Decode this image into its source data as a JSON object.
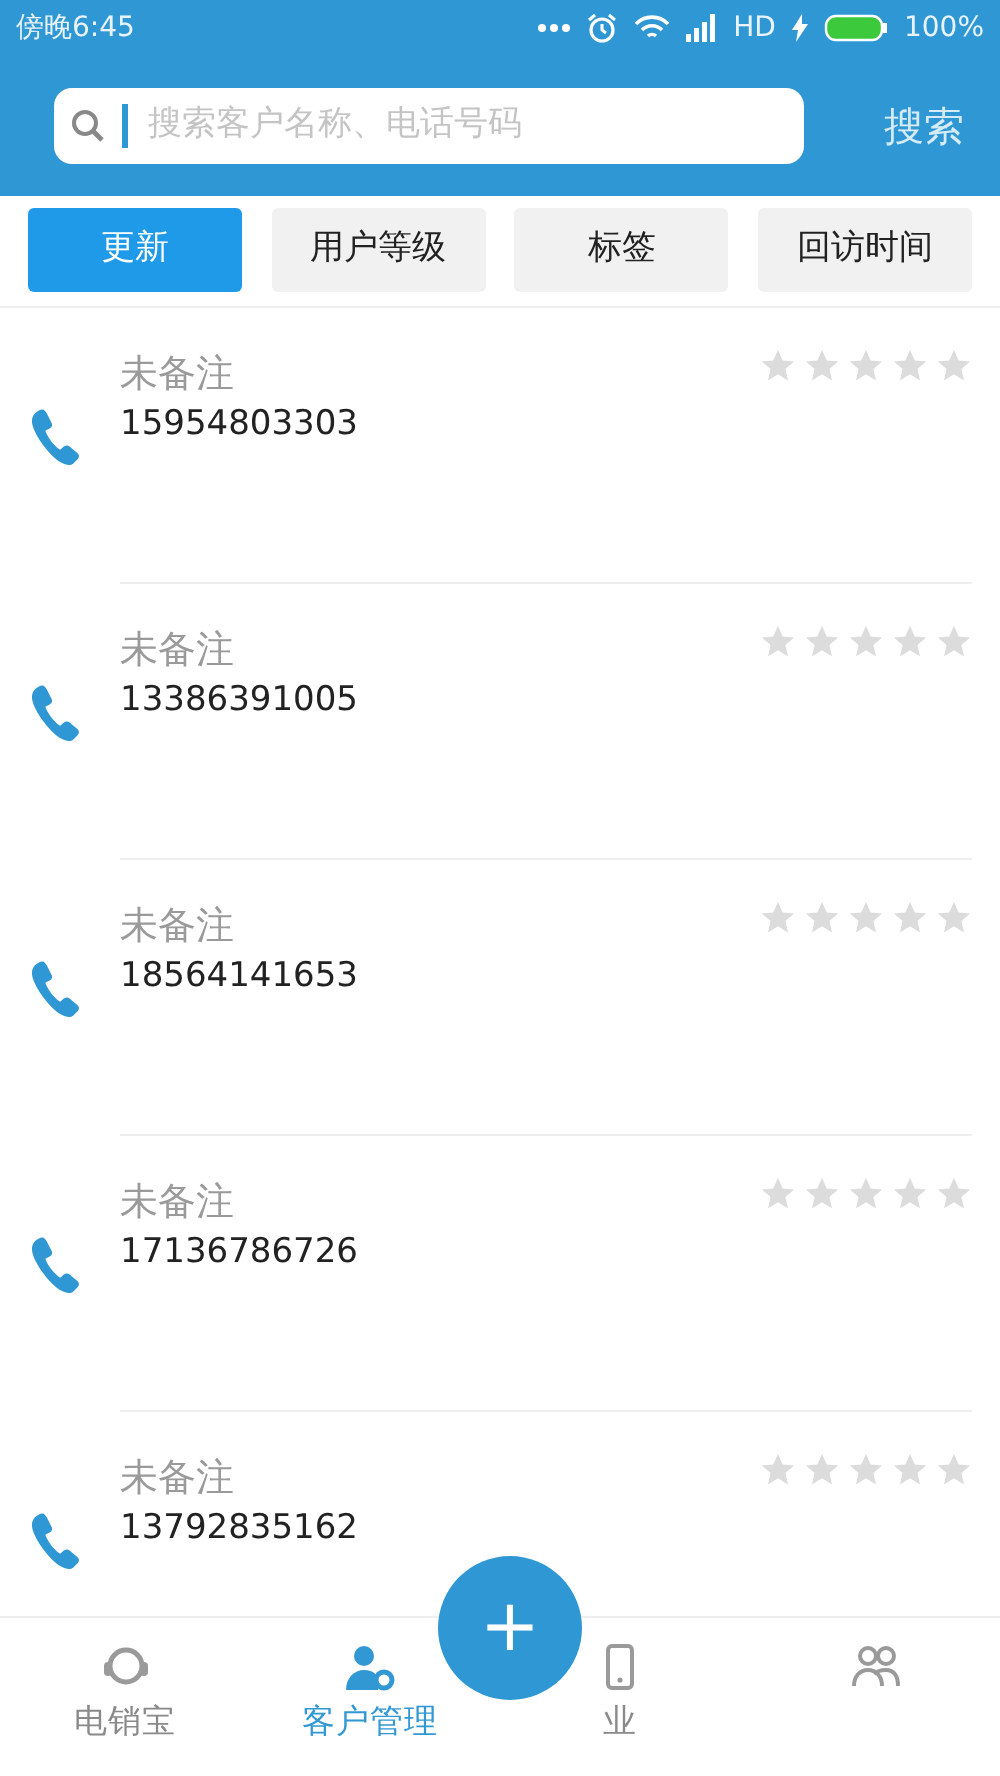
{
  "status_bar": {
    "time": "傍晚6:45",
    "network": "HD",
    "battery": "100%"
  },
  "search": {
    "placeholder": "搜索客户名称、电话号码",
    "button": "搜索"
  },
  "filters": [
    {
      "label": "更新",
      "selected": true
    },
    {
      "label": "用户等级",
      "selected": false
    },
    {
      "label": "标签",
      "selected": false
    },
    {
      "label": "回访时间",
      "selected": false
    }
  ],
  "contacts": [
    {
      "note": "未备注",
      "phone": "15954803303",
      "stars": 0
    },
    {
      "note": "未备注",
      "phone": "13386391005",
      "stars": 0
    },
    {
      "note": "未备注",
      "phone": "18564141653",
      "stars": 0
    },
    {
      "note": "未备注",
      "phone": "17136786726",
      "stars": 0
    },
    {
      "note": "未备注",
      "phone": "13792835162",
      "stars": 0
    }
  ],
  "fab": {
    "label": "+"
  },
  "bottom_nav": [
    {
      "kind": "headset",
      "label": "电销宝",
      "selected": false
    },
    {
      "kind": "person",
      "label": "客户管理",
      "selected": true
    },
    {
      "kind": "mobile",
      "label": "业",
      "selected": false
    },
    {
      "kind": "group",
      "selected": false
    }
  ]
}
